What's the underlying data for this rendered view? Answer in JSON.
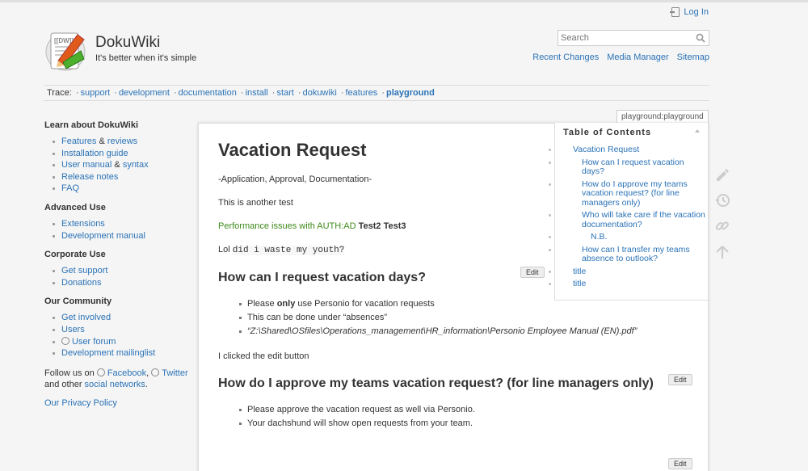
{
  "header": {
    "login_label": "Log In",
    "site_title": "DokuWiki",
    "tagline": "It's better when it's simple",
    "search_placeholder": "Search",
    "links": [
      "Recent Changes",
      "Media Manager",
      "Sitemap"
    ]
  },
  "trace": {
    "label": "Trace:",
    "items": [
      "support",
      "development",
      "documentation",
      "install",
      "start",
      "dokuwiki",
      "features"
    ],
    "current": "playground"
  },
  "sidebar": {
    "learn_title": "Learn about DokuWiki",
    "learn_items": {
      "features": "Features",
      "amp1": " & ",
      "reviews": "reviews",
      "install": "Installation guide",
      "manual": "User manual",
      "amp2": " & ",
      "syntax": "syntax",
      "release": "Release notes",
      "faq": "FAQ"
    },
    "advanced_title": "Advanced Use",
    "advanced_items": [
      "Extensions",
      "Development manual"
    ],
    "corporate_title": "Corporate Use",
    "corporate_items": [
      "Get support",
      "Donations"
    ],
    "community_title": "Our Community",
    "community_items": [
      "Get involved",
      "Users",
      "User forum",
      "Development mailinglist"
    ],
    "follow_prefix": "Follow us on ",
    "facebook": "Facebook",
    "comma": ",",
    "twitter": "Twitter",
    "follow_mid": "and other ",
    "social": "social networks",
    "period": ".",
    "privacy": "Our Privacy Policy"
  },
  "page": {
    "page_id": "playground:playground",
    "title": "Vacation Request",
    "subtitle": "-Application, Approval, Documentation-",
    "p1": "This is another test",
    "p2_green": "Performance issues with AUTH:AD",
    "p2_bold": " Test2 Test3",
    "p3_text": "Lol ",
    "p3_code": "did i waste my youth?",
    "edit_label": "Edit",
    "h2_1": "How can I request vacation days?",
    "s1_li1_a": "Please ",
    "s1_li1_b": "only",
    "s1_li1_c": " use Personio for vacation requests",
    "s1_li2": "This can be done under “absences”",
    "s1_li3": "“Z:\\Shared\\OSfiles\\Operations_management\\HR_information\\Personio Employee Manual (EN).pdf”",
    "p4": "I clicked the edit button",
    "h2_2": "How do I approve my teams vacation request? (for line managers only)",
    "s2_li1": "Please approve the vacation request as well via Personio.",
    "s2_li2": "Your dachshund will show open requests from your team."
  },
  "toc": {
    "title": "Table of Contents",
    "items": [
      "Vacation Request",
      "How can I request vacation days?",
      "How do I approve my teams vacation request? (for line managers only)",
      "Who will take care if the vacation documentation?",
      "N.B.",
      "How can I transfer my teams absence to outlook?",
      "title",
      "title"
    ]
  },
  "pagetools": [
    "edit-icon",
    "history-icon",
    "backlinks-icon",
    "back-to-top-icon"
  ]
}
